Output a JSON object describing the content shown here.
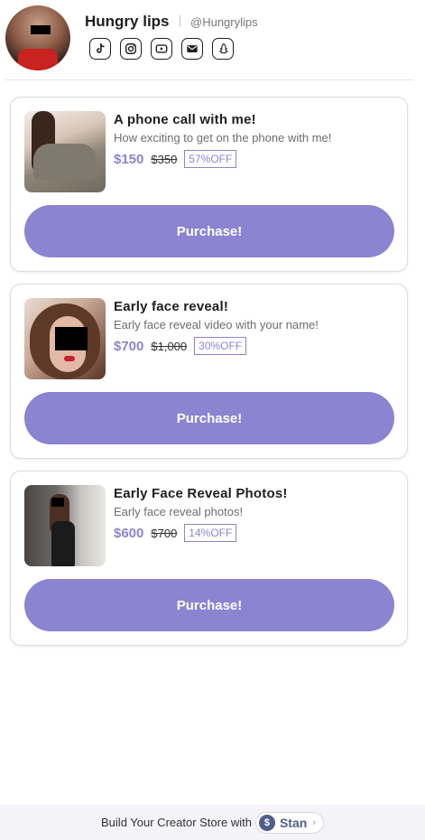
{
  "profile": {
    "name": "Hungry lips",
    "handle": "@Hungrylips",
    "socials": [
      "tiktok-icon",
      "instagram-icon",
      "youtube-icon",
      "email-icon",
      "snapchat-icon"
    ]
  },
  "products": [
    {
      "title": "A phone call with me!",
      "description": "How exciting to get on the phone with me!",
      "price": "$150",
      "old_price": "$350",
      "discount": "57%OFF",
      "button": "Purchase!"
    },
    {
      "title": "Early face reveal!",
      "description": "Early face reveal video with your name!",
      "price": "$700",
      "old_price": "$1,000",
      "discount": "30%OFF",
      "button": "Purchase!"
    },
    {
      "title": "Early Face Reveal Photos!",
      "description": "Early face reveal photos!",
      "price": "$600",
      "old_price": "$700",
      "discount": "14%OFF",
      "button": "Purchase!"
    }
  ],
  "footer": {
    "text": "Build Your Creator Store with",
    "brand": "Stan",
    "logo_glyph": "$"
  },
  "colors": {
    "accent": "#8a84d1",
    "brand": "#4f5e8c"
  }
}
